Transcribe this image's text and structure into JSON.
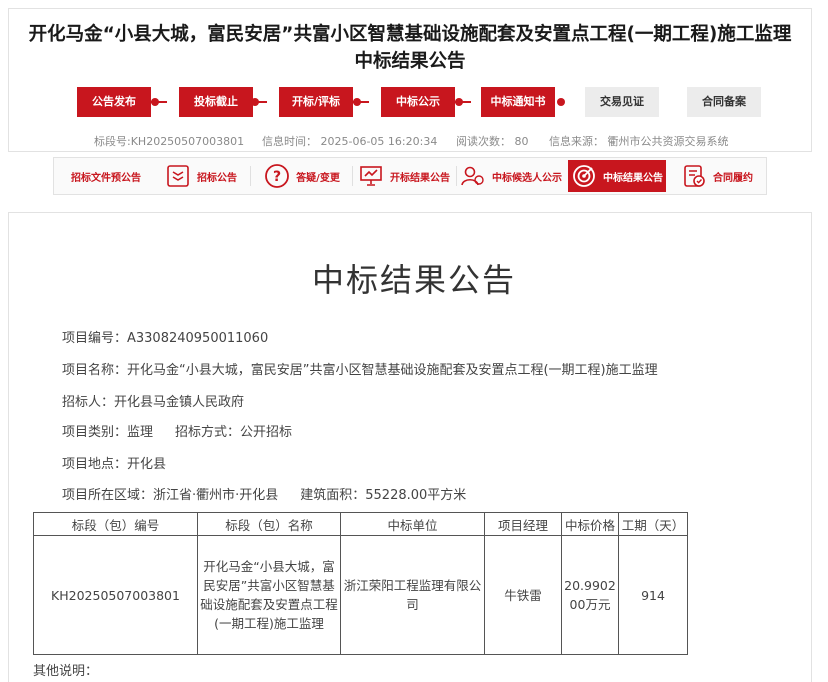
{
  "header": {
    "title_line1": "开化马金“小县大城，富民安居”共富小区智慧基础设施配套及安置点工程(一期工程)施工监理",
    "title_line2": "中标结果公告"
  },
  "steps": [
    {
      "label": "公告发布",
      "done": true
    },
    {
      "label": "投标截止",
      "done": true
    },
    {
      "label": "开标/评标",
      "done": true
    },
    {
      "label": "中标公示",
      "done": true
    },
    {
      "label": "中标通知书",
      "done": true
    },
    {
      "label": "交易见证",
      "done": false
    },
    {
      "label": "合同备案",
      "done": false
    }
  ],
  "meta": {
    "section_no": "标段号:KH20250507003801",
    "info_time": "信息时间：  2025-06-05 16:20:34",
    "views": "阅读次数：  80",
    "source": "信息来源：  衢州市公共资源交易系统"
  },
  "tabs": [
    {
      "label": "招标文件预公告",
      "icon": "document-preview-icon"
    },
    {
      "label": "招标公告",
      "icon": "notice-list-icon"
    },
    {
      "label": "答疑/变更",
      "icon": "question-icon"
    },
    {
      "label": "开标结果公告",
      "icon": "presentation-icon"
    },
    {
      "label": "中标候选人公示",
      "icon": "candidate-icon"
    },
    {
      "label": "中标结果公告",
      "icon": "target-icon",
      "active": true
    },
    {
      "label": "合同履约",
      "icon": "contract-icon"
    }
  ],
  "doc": {
    "title": "中标结果公告",
    "project_no": "项目编号：A3308240950011060",
    "project_name": "项目名称：开化马金“小县大城，富民安居”共富小区智慧基础设施配套及安置点工程(一期工程)施工监理",
    "tenderer": "招标人：开化县马金镇人民政府",
    "category": "项目类别：监理",
    "method": "招标方式：公开招标",
    "location": "项目地点：开化县",
    "region": "项目所在区域：浙江省·衢州市·开化县",
    "area": "建筑面积：55228.00平方米",
    "other_notes": "其他说明："
  },
  "table": {
    "headers": [
      "标段（包）编号",
      "标段（包）名称",
      "中标单位",
      "项目经理",
      "中标价格",
      "工期（天）"
    ],
    "row": {
      "section_no": "KH20250507003801",
      "section_name": "开化马金“小县大城，富民安居”共富小区智慧基础设施配套及安置点工程(一期工程)施工监理",
      "winner": "浙江荣阳工程监理有限公司",
      "manager": "牛铁雷",
      "price": "20.990200万元",
      "duration": "914"
    }
  },
  "colors": {
    "accent": "#c8161e",
    "inactive_step": "#ececec"
  }
}
